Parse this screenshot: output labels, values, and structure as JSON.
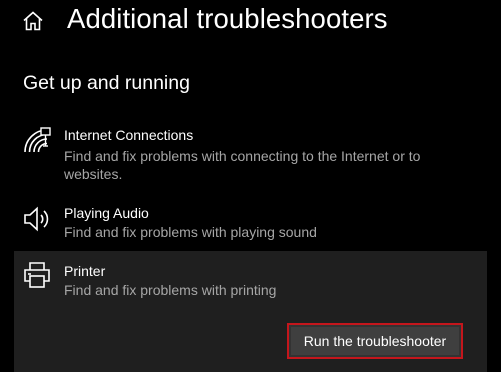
{
  "header": {
    "title": "Additional troubleshooters",
    "home_icon": "home-icon"
  },
  "section": {
    "title": "Get up and running"
  },
  "items": [
    {
      "name": "Internet Connections",
      "description": "Find and fix problems with connecting to the Internet or to websites.",
      "icon": "wifi-icon"
    },
    {
      "name": "Playing Audio",
      "description": "Find and fix problems with playing sound",
      "icon": "speaker-icon"
    },
    {
      "name": "Printer",
      "description": "Find and fix problems with printing",
      "icon": "printer-icon",
      "selected": true,
      "button_label": "Run the troubleshooter"
    }
  ],
  "colors": {
    "background": "#000000",
    "selected_item_background": "#1f1f1f",
    "description_text": "#a6a6a6",
    "button_background": "#3f3f3f",
    "highlight_border": "#c4161c"
  }
}
